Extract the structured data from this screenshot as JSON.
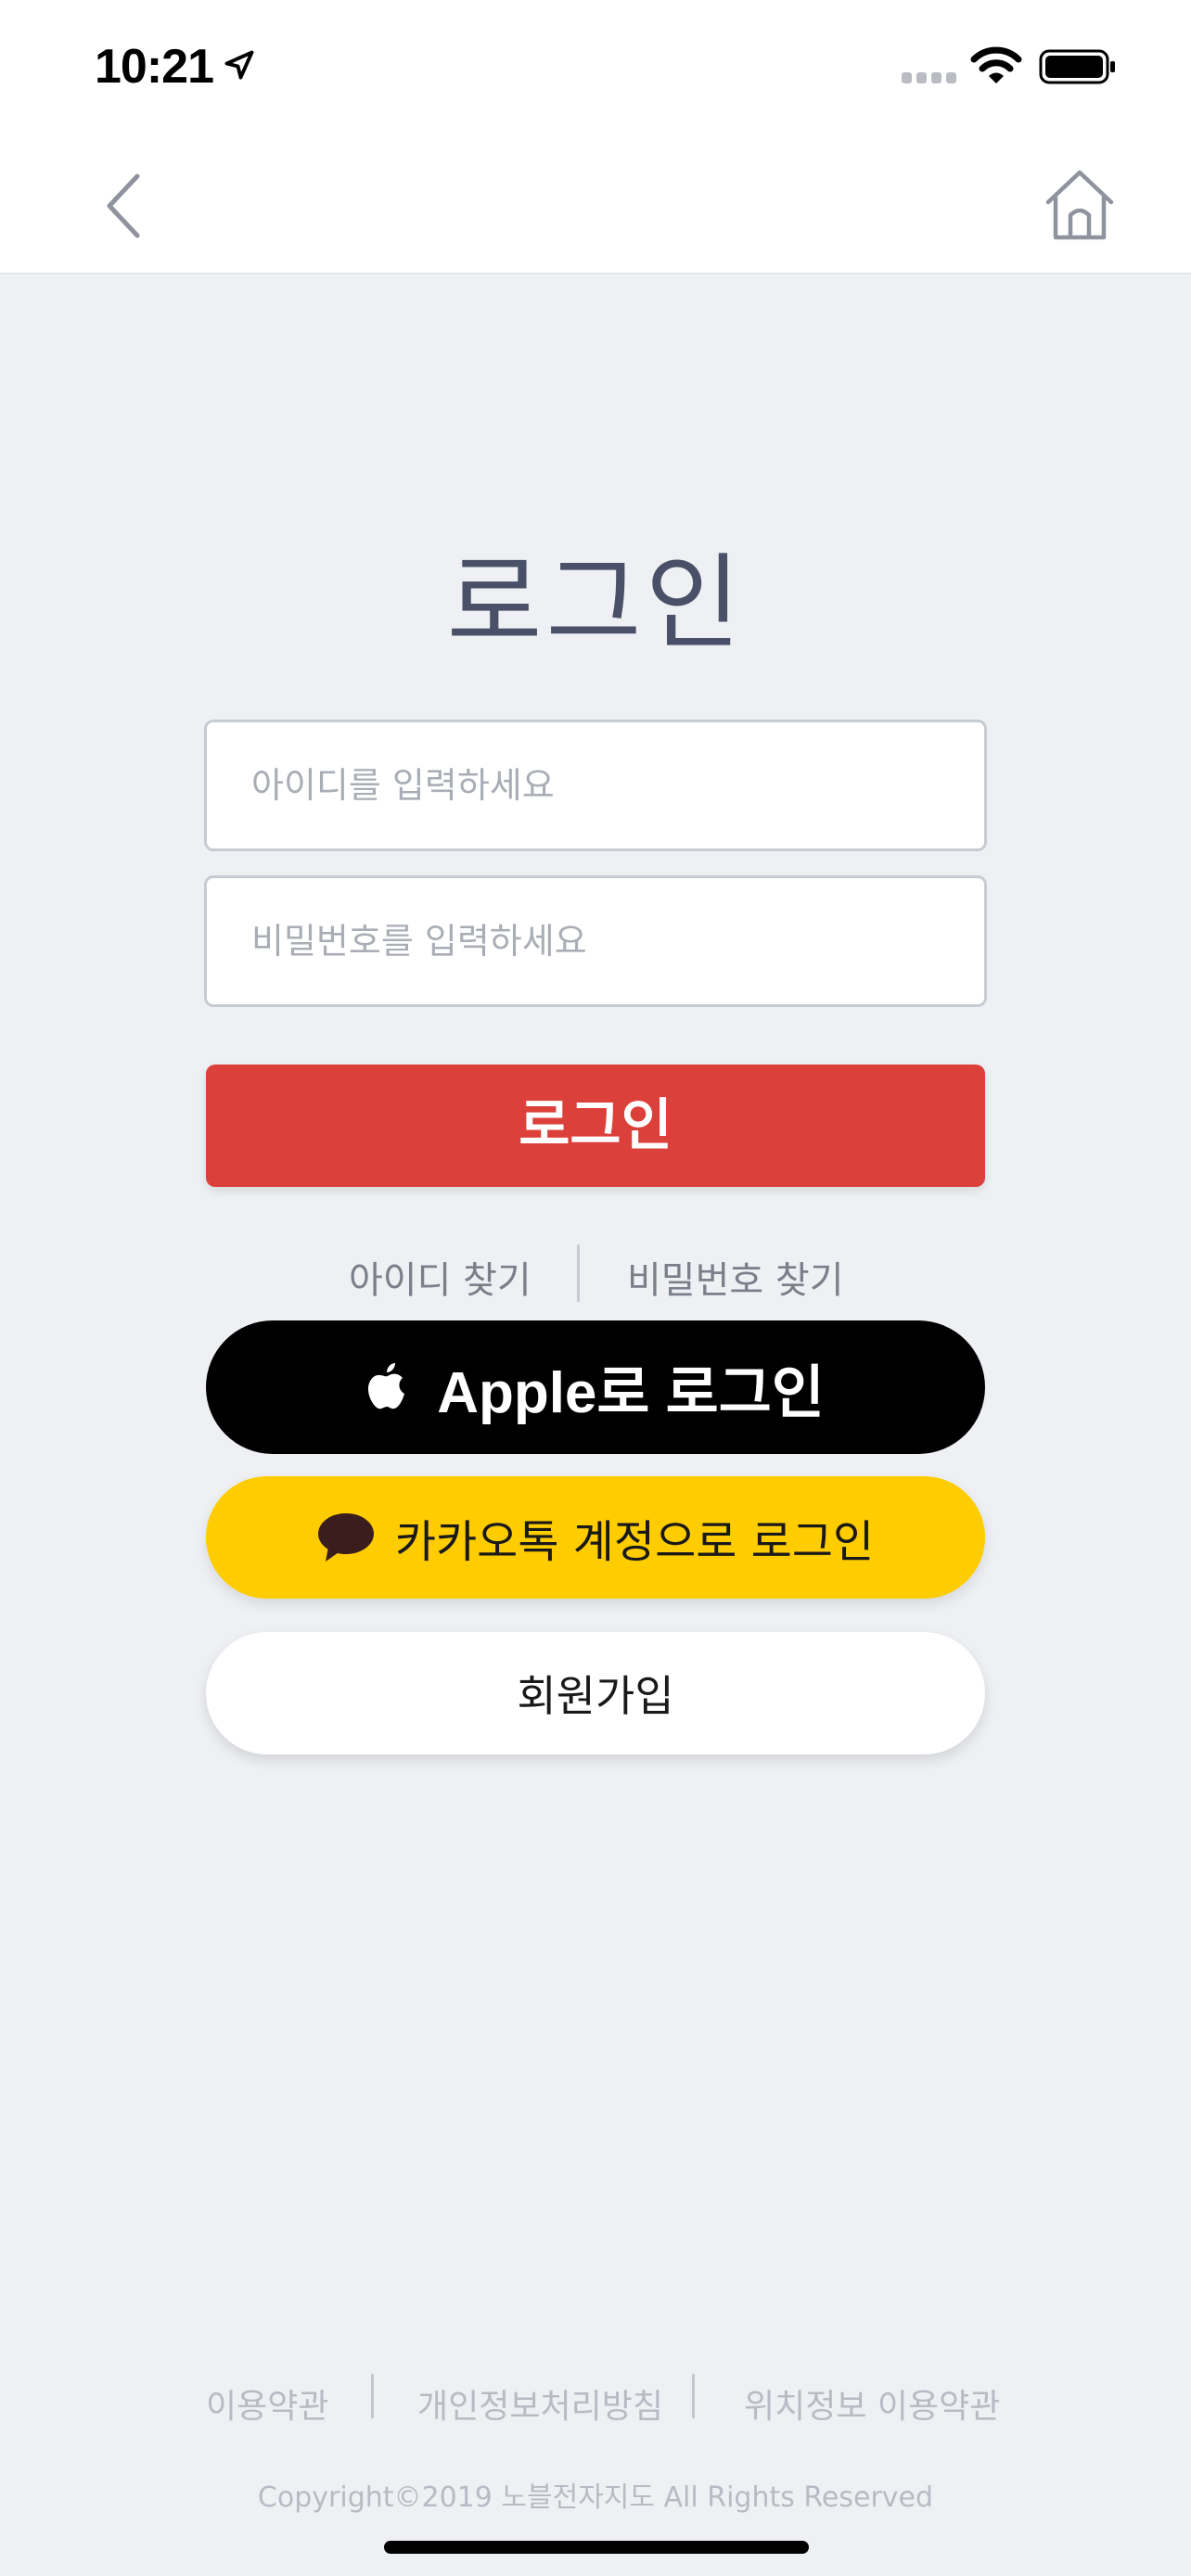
{
  "status_bar": {
    "time": "10:21"
  },
  "nav": {
    "back_icon": "chevron-left-icon",
    "home_icon": "home-icon"
  },
  "login": {
    "title": "로그인",
    "id_placeholder": "아이디를 입력하세요",
    "pw_placeholder": "비밀번호를 입력하세요",
    "login_button": "로그인",
    "find_id": "아이디 찾기",
    "find_pw": "비밀번호 찾기"
  },
  "social": {
    "apple_label": "Apple로 로그인",
    "kakao_label": "카카오톡 계정으로 로그인",
    "signup_label": "회원가입"
  },
  "footer": {
    "terms": "이용약관",
    "privacy": "개인정보처리방침",
    "location_terms": "위치정보 이용약관",
    "copyright": "Copyright©2019 노블전자지도 All Rights Reserved"
  },
  "colors": {
    "background": "#eef0f4",
    "login_red": "#db403a",
    "kakao_yellow": "#ffcc00",
    "title": "#4a5068"
  }
}
